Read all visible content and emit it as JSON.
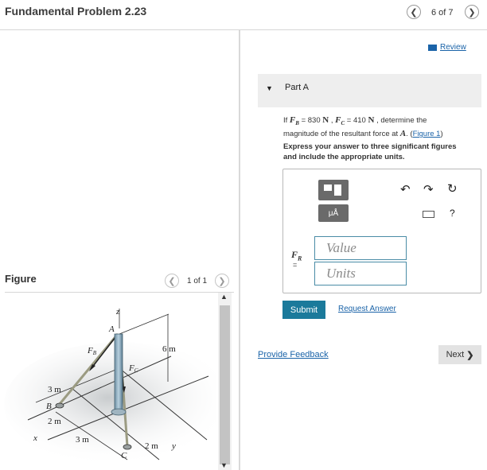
{
  "header": {
    "title": "Fundamental Problem 2.23",
    "pager": "6 of 7"
  },
  "review": {
    "label": "Review"
  },
  "part": {
    "label": "Part A"
  },
  "question": {
    "intro": "If",
    "fb_symbol": "F",
    "fb_sub": "B",
    "fb_value": " = 830 ",
    "fb_unit": "N",
    "sep": " , ",
    "fc_symbol": "F",
    "fc_sub": "C",
    "fc_value": " = 410 ",
    "fc_unit": "N",
    "line1_tail": " , determine the",
    "line2": "magnitude of the resultant force at ",
    "point": "A",
    "line2_tail": ". (",
    "figure_link": "Figure 1",
    "close": ")",
    "instruction_line1": "Express your answer to three significant figures",
    "instruction_line2": "and include the appropriate units."
  },
  "answer": {
    "var_symbol": "F",
    "var_sub": "R",
    "equals": "=",
    "value_placeholder": "Value",
    "units_placeholder": "Units",
    "units_tool": "μÅ",
    "help": "?"
  },
  "actions": {
    "submit": "Submit",
    "request": "Request Answer",
    "feedback": "Provide Feedback",
    "next": "Next"
  },
  "figure": {
    "heading": "Figure",
    "pager": "1 of 1",
    "labels": {
      "z": "z",
      "a": "A",
      "fb": "F",
      "fb_sub": "B",
      "fc": "F",
      "fc_sub": "C",
      "h": "6 m",
      "d1": "3 m",
      "b": "B",
      "d2": "2 m",
      "x": "x",
      "d3": "3 m",
      "c": "C",
      "d4": "2 m",
      "y": "y"
    }
  }
}
